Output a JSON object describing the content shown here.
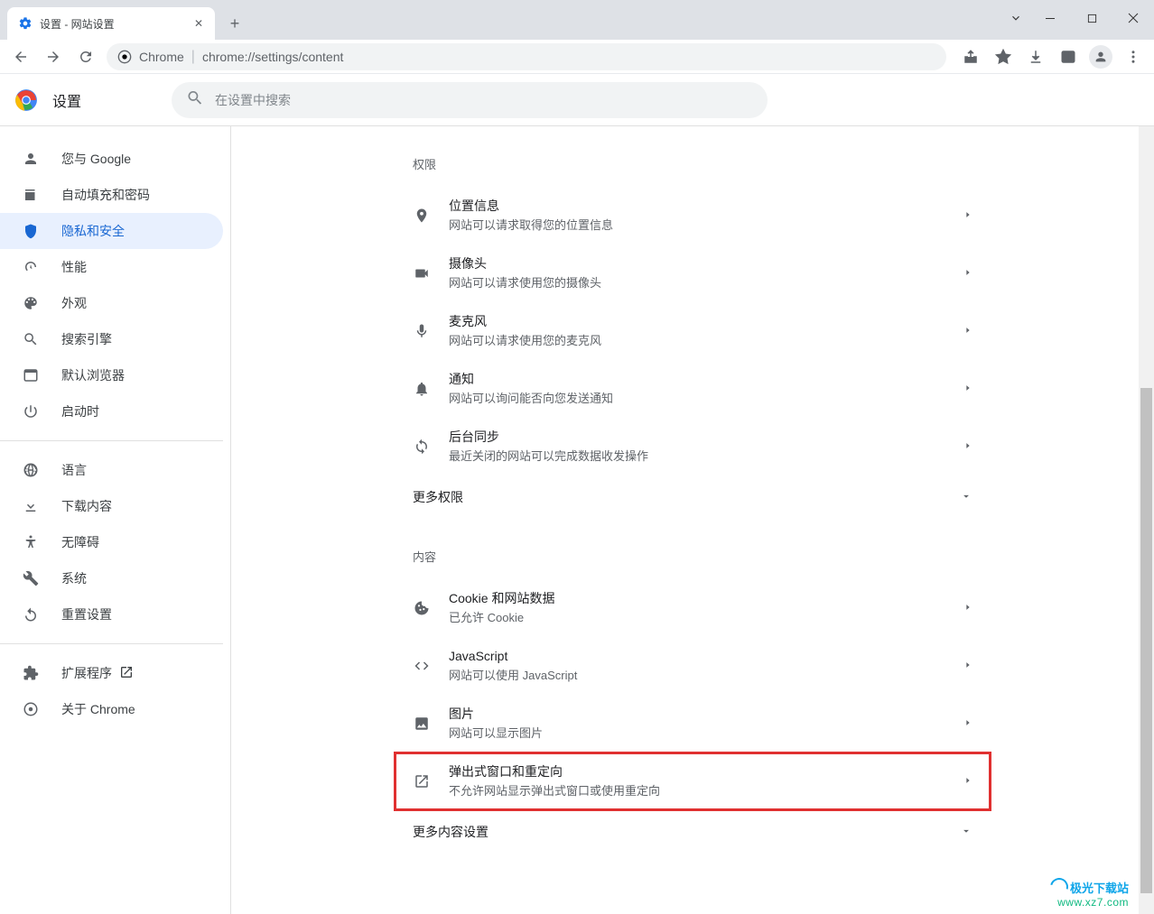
{
  "window": {
    "tab_title": "设置 - 网站设置"
  },
  "toolbar": {
    "omnibox_prefix": "Chrome",
    "omnibox_url": "chrome://settings/content"
  },
  "header": {
    "title": "设置",
    "search_placeholder": "在设置中搜索"
  },
  "sidebar": {
    "items": [
      {
        "label": "您与 Google",
        "icon": "person"
      },
      {
        "label": "自动填充和密码",
        "icon": "autofill"
      },
      {
        "label": "隐私和安全",
        "icon": "shield",
        "active": true
      },
      {
        "label": "性能",
        "icon": "speed"
      },
      {
        "label": "外观",
        "icon": "palette"
      },
      {
        "label": "搜索引擎",
        "icon": "search"
      },
      {
        "label": "默认浏览器",
        "icon": "browser"
      },
      {
        "label": "启动时",
        "icon": "power"
      }
    ],
    "items2": [
      {
        "label": "语言",
        "icon": "language"
      },
      {
        "label": "下载内容",
        "icon": "download"
      },
      {
        "label": "无障碍",
        "icon": "accessibility"
      },
      {
        "label": "系统",
        "icon": "system"
      },
      {
        "label": "重置设置",
        "icon": "reset"
      }
    ],
    "items3": [
      {
        "label": "扩展程序",
        "icon": "extension",
        "external": true
      },
      {
        "label": "关于 Chrome",
        "icon": "chrome"
      }
    ]
  },
  "main": {
    "sections": [
      {
        "label": "权限",
        "rows": [
          {
            "icon": "location",
            "title": "位置信息",
            "desc": "网站可以请求取得您的位置信息"
          },
          {
            "icon": "camera",
            "title": "摄像头",
            "desc": "网站可以请求使用您的摄像头"
          },
          {
            "icon": "mic",
            "title": "麦克风",
            "desc": "网站可以请求使用您的麦克风"
          },
          {
            "icon": "bell",
            "title": "通知",
            "desc": "网站可以询问能否向您发送通知"
          },
          {
            "icon": "sync",
            "title": "后台同步",
            "desc": "最近关闭的网站可以完成数据收发操作"
          }
        ],
        "expand_label": "更多权限"
      },
      {
        "label": "内容",
        "rows": [
          {
            "icon": "cookie",
            "title": "Cookie 和网站数据",
            "desc": "已允许 Cookie"
          },
          {
            "icon": "code",
            "title": "JavaScript",
            "desc": "网站可以使用 JavaScript"
          },
          {
            "icon": "image",
            "title": "图片",
            "desc": "网站可以显示图片"
          },
          {
            "icon": "popup",
            "title": "弹出式窗口和重定向",
            "desc": "不允许网站显示弹出式窗口或使用重定向",
            "highlighted": true
          }
        ],
        "expand_label": "更多内容设置"
      }
    ]
  },
  "watermark": {
    "brand": "极光下载站",
    "url": "www.xz7.com"
  }
}
